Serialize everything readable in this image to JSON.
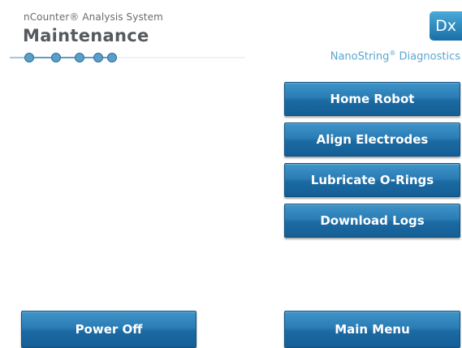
{
  "header": {
    "app_title": "nCounter® Analysis System",
    "page_title": "Maintenance",
    "brand_badge": "Dx",
    "brand_name": "NanoString",
    "brand_reg": "®",
    "brand_suffix": " Diagnostics"
  },
  "progress": {
    "dots": 5
  },
  "actions": {
    "home_robot": "Home Robot",
    "align_electrodes": "Align Electrodes",
    "lubricate_orings": "Lubricate O-Rings",
    "download_logs": "Download Logs"
  },
  "footer": {
    "power_off": "Power Off",
    "main_menu": "Main Menu"
  },
  "colors": {
    "accent": "#2a7db5",
    "brand_text": "#5aa6cf",
    "progress_line": "#7fb6d6"
  }
}
